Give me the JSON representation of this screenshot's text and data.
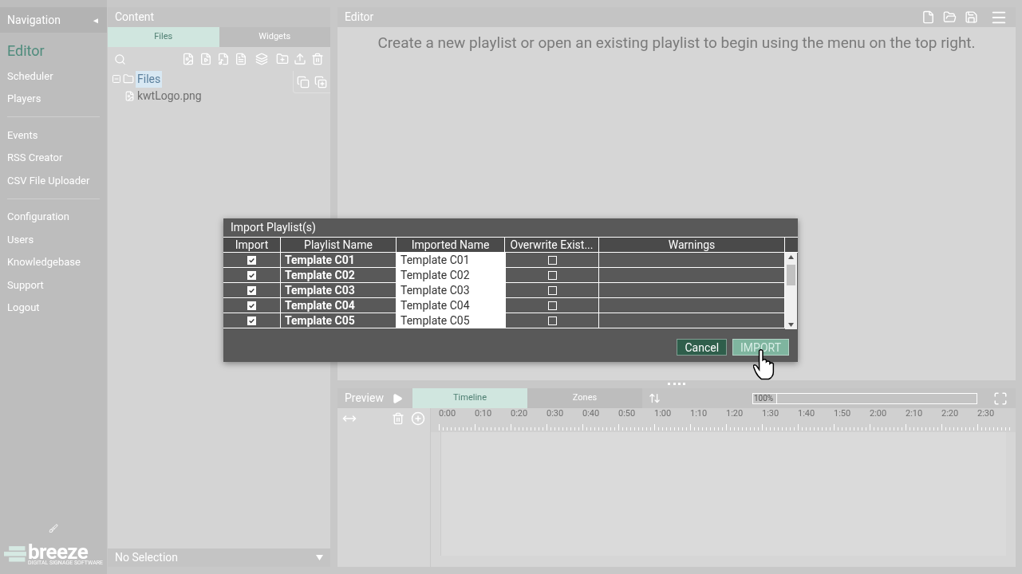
{
  "navigation": {
    "title": "Navigation",
    "collapse_glyph": "◄",
    "groups": [
      [
        {
          "label": "Editor",
          "selected": true
        },
        {
          "label": "Scheduler",
          "selected": false
        },
        {
          "label": "Players",
          "selected": false
        }
      ],
      [
        {
          "label": "Events",
          "selected": false
        },
        {
          "label": "RSS Creator",
          "selected": false
        },
        {
          "label": "CSV File Uploader",
          "selected": false
        }
      ],
      [
        {
          "label": "Configuration",
          "selected": false
        },
        {
          "label": "Users",
          "selected": false
        },
        {
          "label": "Knowledgebase",
          "selected": false
        },
        {
          "label": "Support",
          "selected": false
        },
        {
          "label": "Logout",
          "selected": false
        }
      ]
    ],
    "logo": {
      "name": "breeze",
      "tagline": "DIGITAL SIGNAGE SOFTWARE"
    }
  },
  "content": {
    "title": "Content",
    "tabs": [
      {
        "label": "Files",
        "selected": true
      },
      {
        "label": "Widgets",
        "selected": false
      }
    ],
    "tree": {
      "label": "Files",
      "expanded": true,
      "selected": true,
      "children": [
        {
          "label": "kwtLogo.png"
        }
      ]
    },
    "selection": "No Selection"
  },
  "editor": {
    "title": "Editor",
    "message": "Create a new playlist or open an existing playlist to begin using the menu on the top right."
  },
  "preview": {
    "title": "Preview",
    "tabs": [
      {
        "label": "Timeline",
        "selected": true
      },
      {
        "label": "Zones",
        "selected": false
      }
    ],
    "zoom": "100%",
    "timeline_labels": [
      "0:00",
      "0:10",
      "0:20",
      "0:30",
      "0:40",
      "0:50",
      "1:00",
      "1:10",
      "1:20",
      "1:30",
      "1:40",
      "1:50",
      "2:00",
      "2:10",
      "2:20",
      "2:30"
    ]
  },
  "dialog": {
    "title": "Import Playlist(s)",
    "columns": [
      "Import",
      "Playlist Name",
      "Imported Name",
      "Overwrite Exist...",
      "Warnings"
    ],
    "rows": [
      {
        "import": true,
        "playlist_name": "Template C01",
        "imported_name": "Template C01",
        "overwrite": false
      },
      {
        "import": true,
        "playlist_name": "Template C02",
        "imported_name": "Template C02",
        "overwrite": false
      },
      {
        "import": true,
        "playlist_name": "Template C03",
        "imported_name": "Template C03",
        "overwrite": false
      },
      {
        "import": true,
        "playlist_name": "Template C04",
        "imported_name": "Template C04",
        "overwrite": false
      },
      {
        "import": true,
        "playlist_name": "Template C05",
        "imported_name": "Template C05",
        "overwrite": false
      }
    ],
    "buttons": [
      {
        "label": "Cancel",
        "kind": "secondary"
      },
      {
        "label": "IMPORT",
        "kind": "primary"
      }
    ]
  }
}
